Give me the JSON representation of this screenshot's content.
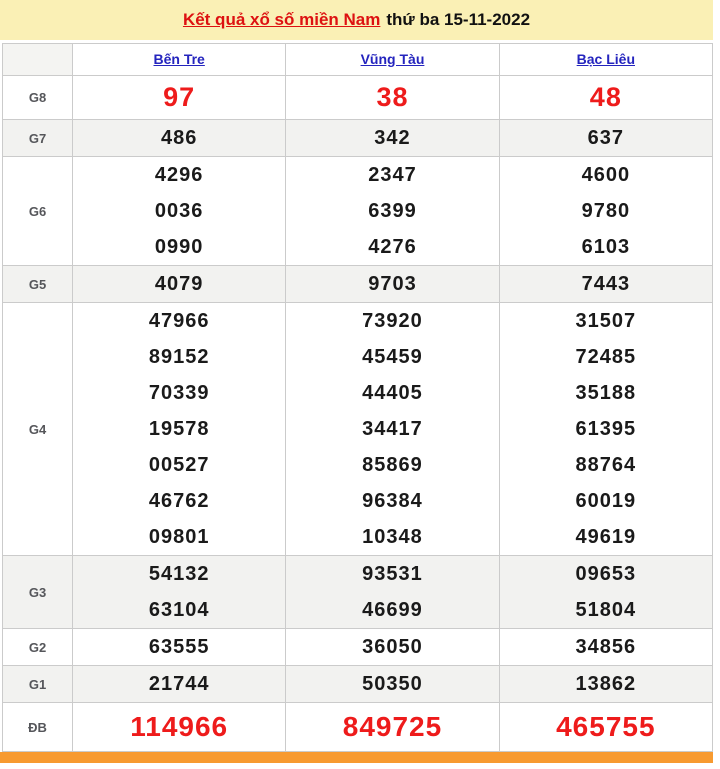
{
  "page": {
    "title_link": "Kết quả xổ số miền Nam",
    "title_rest": "thứ ba 15-11-2022"
  },
  "table": {
    "columns": [
      "Bến Tre",
      "Vũng Tàu",
      "Bạc Liêu"
    ],
    "prizes": [
      {
        "label": "G8",
        "variant": "red-medium",
        "shaded": false,
        "lines": [
          [
            "97",
            "38",
            "48"
          ]
        ]
      },
      {
        "label": "G7",
        "variant": "normal",
        "shaded": true,
        "lines": [
          [
            "486",
            "342",
            "637"
          ]
        ]
      },
      {
        "label": "G6",
        "variant": "normal",
        "shaded": false,
        "lines": [
          [
            "4296",
            "2347",
            "4600"
          ],
          [
            "0036",
            "6399",
            "9780"
          ],
          [
            "0990",
            "4276",
            "6103"
          ]
        ]
      },
      {
        "label": "G5",
        "variant": "normal",
        "shaded": true,
        "lines": [
          [
            "4079",
            "9703",
            "7443"
          ]
        ]
      },
      {
        "label": "G4",
        "variant": "normal",
        "shaded": false,
        "lines": [
          [
            "47966",
            "73920",
            "31507"
          ],
          [
            "89152",
            "45459",
            "72485"
          ],
          [
            "70339",
            "44405",
            "35188"
          ],
          [
            "19578",
            "34417",
            "61395"
          ],
          [
            "00527",
            "85869",
            "88764"
          ],
          [
            "46762",
            "96384",
            "60019"
          ],
          [
            "09801",
            "10348",
            "49619"
          ]
        ]
      },
      {
        "label": "G3",
        "variant": "normal",
        "shaded": true,
        "lines": [
          [
            "54132",
            "93531",
            "09653"
          ],
          [
            "63104",
            "46699",
            "51804"
          ]
        ]
      },
      {
        "label": "G2",
        "variant": "normal",
        "shaded": false,
        "lines": [
          [
            "63555",
            "36050",
            "34856"
          ]
        ]
      },
      {
        "label": "G1",
        "variant": "normal",
        "shaded": true,
        "lines": [
          [
            "21744",
            "50350",
            "13862"
          ]
        ]
      },
      {
        "label": "ĐB",
        "variant": "red-large",
        "shaded": false,
        "lines": [
          [
            "114966",
            "849725",
            "465755"
          ]
        ]
      }
    ]
  },
  "colors": {
    "title_band_bg": "#FAF0B5",
    "title_link": "#DD1111",
    "header_link": "#2424BE",
    "red_number": "#EE1B1B",
    "number_color": "#1A1A1A",
    "shaded_row_bg": "#F2F2F0",
    "corner_cell_bg": "#F4F4F2",
    "border": "#CBCBCB",
    "footer_bar": "#F79A30"
  }
}
